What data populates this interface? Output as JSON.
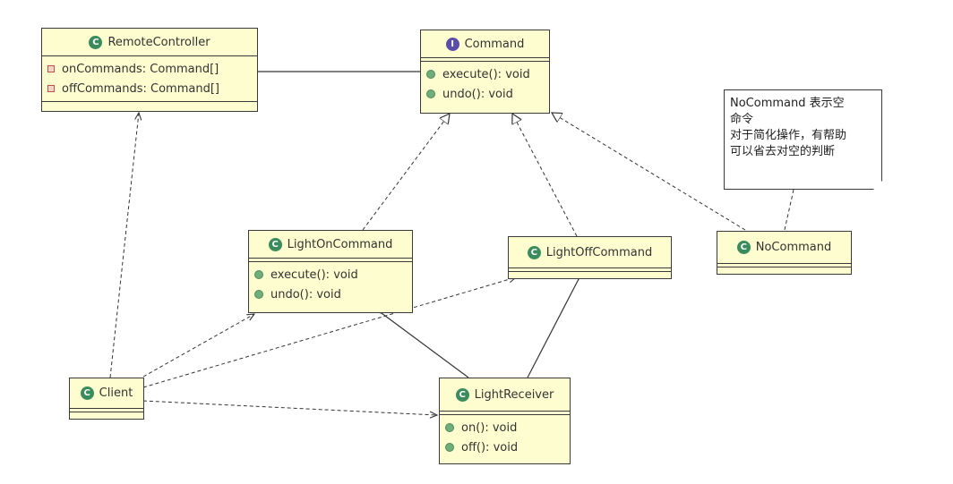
{
  "classes": {
    "remote_controller": {
      "name": "RemoteController",
      "stereotype": "class-icon",
      "fields": [
        {
          "visibility": "private",
          "text": "onCommands: Command[]"
        },
        {
          "visibility": "private",
          "text": "offCommands: Command[]"
        }
      ]
    },
    "command": {
      "name": "Command",
      "stereotype": "interface-icon",
      "methods": [
        {
          "visibility": "public",
          "text": "execute(): void"
        },
        {
          "visibility": "public",
          "text": "undo(): void"
        }
      ]
    },
    "light_on_command": {
      "name": "LightOnCommand",
      "stereotype": "class-icon",
      "methods": [
        {
          "visibility": "public",
          "text": "execute(): void"
        },
        {
          "visibility": "public",
          "text": "undo(): void"
        }
      ]
    },
    "light_off_command": {
      "name": "LightOffCommand",
      "stereotype": "class-icon"
    },
    "no_command": {
      "name": "NoCommand",
      "stereotype": "class-icon"
    },
    "client": {
      "name": "Client",
      "stereotype": "class-icon"
    },
    "light_receiver": {
      "name": "LightReceiver",
      "stereotype": "class-icon",
      "methods": [
        {
          "visibility": "public",
          "text": "on(): void"
        },
        {
          "visibility": "public",
          "text": "off(): void"
        }
      ]
    }
  },
  "badges": {
    "class": "C",
    "interface": "I"
  },
  "note": {
    "lines": [
      "NoCommand 表示空",
      "命令",
      "对于简化操作，有帮助",
      "可以省去对空的判断"
    ]
  },
  "relationships": [
    {
      "from": "RemoteController",
      "to": "Command",
      "type": "aggregation"
    },
    {
      "from": "LightOnCommand",
      "to": "Command",
      "type": "realization"
    },
    {
      "from": "LightOffCommand",
      "to": "Command",
      "type": "realization"
    },
    {
      "from": "NoCommand",
      "to": "Command",
      "type": "realization"
    },
    {
      "from": "LightOnCommand",
      "to": "LightReceiver",
      "type": "aggregation"
    },
    {
      "from": "LightOffCommand",
      "to": "LightReceiver",
      "type": "aggregation"
    },
    {
      "from": "Client",
      "to": "RemoteController",
      "type": "dependency"
    },
    {
      "from": "Client",
      "to": "LightOnCommand",
      "type": "dependency"
    },
    {
      "from": "Client",
      "to": "LightOffCommand",
      "type": "dependency"
    },
    {
      "from": "Client",
      "to": "LightReceiver",
      "type": "dependency"
    },
    {
      "from": "Note",
      "to": "NoCommand",
      "type": "note-anchor"
    }
  ],
  "colors": {
    "class_fill": "#fdfdcf",
    "border": "#3a3a3a",
    "class_badge": "#3a8c5c",
    "interface_badge": "#5a4ea8",
    "method_dot": "#6fae7a",
    "private_field": "#c05050"
  }
}
